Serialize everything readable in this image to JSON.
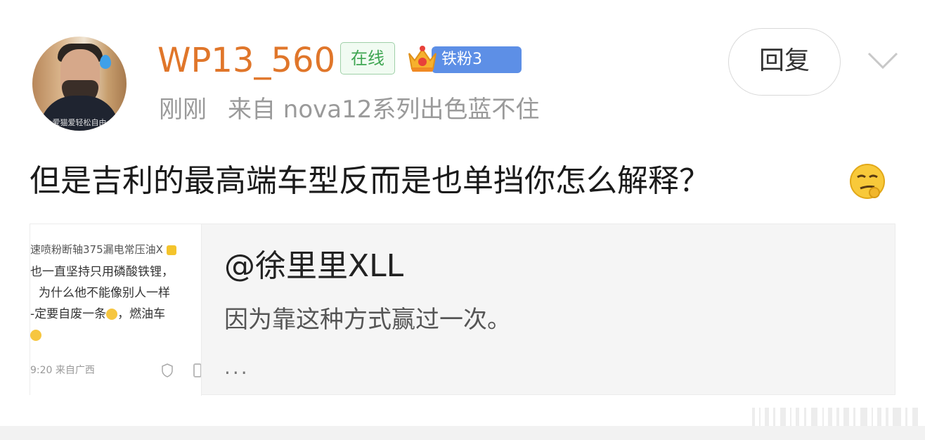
{
  "comment": {
    "username": "WP13_560",
    "online_badge": "在线",
    "fan_badge": "铁粉3",
    "time": "刚刚",
    "source": "来自 nova12系列出色蓝不住",
    "reply_label": "回复",
    "text": "但是吉利的最高端车型反而是也单挡你怎么解释？",
    "avatar_caption": "爱猫爱轻松自由",
    "emoji_icon": "smirk-face-emoji"
  },
  "quote": {
    "author": "@徐里里XLL",
    "text": "因为靠这种方式赢过一次。",
    "more": "...",
    "thumb_lines": [
      "速喷粉断轴375漏电常压油X",
      "也一直坚持只用磷酸铁锂，",
      "为什么他不能像别人一样",
      "-定要自废一条",
      "，燃油车"
    ],
    "thumb_footer": "9:20 来自广西"
  },
  "colors": {
    "username": "#e0762a",
    "online_green": "#3fa652",
    "fan_blue": "#5d8fe6"
  }
}
